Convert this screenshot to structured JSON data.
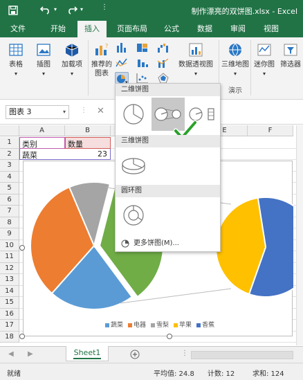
{
  "window": {
    "title": "制作漂亮的双饼图.xlsx - Excel"
  },
  "quick_access": {
    "save_icon": "save-icon",
    "undo_icon": "undo-icon",
    "redo_icon": "redo-icon"
  },
  "tabs": [
    {
      "label": "文件",
      "active": false
    },
    {
      "label": "开始",
      "active": false
    },
    {
      "label": "插入",
      "active": true
    },
    {
      "label": "页面布局",
      "active": false
    },
    {
      "label": "公式",
      "active": false
    },
    {
      "label": "数据",
      "active": false
    },
    {
      "label": "审阅",
      "active": false
    },
    {
      "label": "视图",
      "active": false
    }
  ],
  "ribbon": {
    "table": "表格",
    "illustrations": "插图",
    "addins": "加载项",
    "recommended_charts": "推荐的图表",
    "pivot_chart": "数据透视图",
    "map_3d": "三维地图",
    "tours_group": "演示",
    "sparklines": "迷你图",
    "filters": "筛选器"
  },
  "formula_bar": {
    "name_box": "图表 3",
    "cancel": "✕"
  },
  "columns": [
    "A",
    "B",
    "C",
    "D",
    "E",
    "F"
  ],
  "rows": [
    "1",
    "2",
    "3",
    "4",
    "5",
    "6",
    "7",
    "8",
    "9",
    "10",
    "11",
    "12",
    "13",
    "14",
    "15",
    "16",
    "17",
    "18"
  ],
  "cells": {
    "a1": "类别",
    "b1": "数量",
    "a2": "蔬菜",
    "b2": "23"
  },
  "chart_data": {
    "type": "pie",
    "categories": [
      "蔬菜",
      "电器",
      "雪梨",
      "苹果",
      "香蕉"
    ],
    "values": [
      23,
      34,
      11,
      16,
      22
    ],
    "colors": [
      "#5b9bd5",
      "#ed7d31",
      "#a5a5a5",
      "#ffc000",
      "#4472c4"
    ],
    "main_pie_extra_color": "#70ad47",
    "legend_position": "bottom"
  },
  "dropdown": {
    "section_2d": "二维饼图",
    "section_3d": "三维饼图",
    "section_donut": "圆环图",
    "more": "更多饼图(M)..."
  },
  "sheets": [
    {
      "name": "Sheet1",
      "active": true
    }
  ],
  "status": {
    "ready": "就绪",
    "average": "平均值: 24.8",
    "count": "计数: 12",
    "sum": "求和: 124"
  },
  "colors": {
    "excel_green": "#217346",
    "confirm_check": "#2aa12a"
  }
}
